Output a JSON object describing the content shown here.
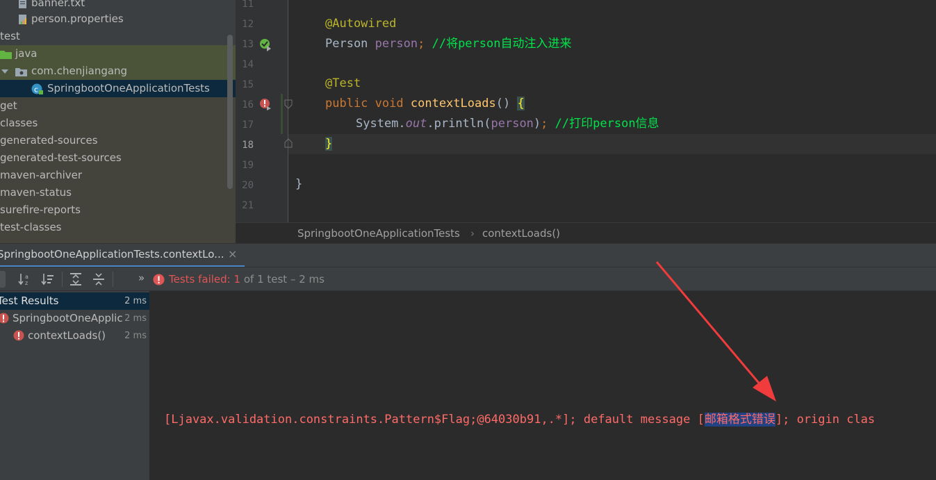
{
  "project_tree": {
    "items": [
      {
        "label": "banner.txt",
        "icon": "text-file-icon"
      },
      {
        "label": "person.properties",
        "icon": "properties-file-icon"
      },
      {
        "label": "test",
        "icon": "none"
      },
      {
        "label": "java",
        "icon": "folder-icon"
      },
      {
        "label": "com.chenjiangang",
        "icon": "package-icon"
      },
      {
        "label": "SpringbootOneApplicationTests",
        "icon": "test-class-icon"
      },
      {
        "label": "get",
        "icon": "none"
      },
      {
        "label": "classes",
        "icon": "none"
      },
      {
        "label": "generated-sources",
        "icon": "none"
      },
      {
        "label": "generated-test-sources",
        "icon": "none"
      },
      {
        "label": "maven-archiver",
        "icon": "none"
      },
      {
        "label": "maven-status",
        "icon": "none"
      },
      {
        "label": "surefire-reports",
        "icon": "none"
      },
      {
        "label": "test-classes",
        "icon": "none"
      }
    ]
  },
  "editor": {
    "line_numbers": [
      "11",
      "12",
      "13",
      "14",
      "15",
      "16",
      "17",
      "18",
      "19",
      "20",
      "21"
    ],
    "code": {
      "l12": "@Autowired",
      "l13_type": "Person",
      "l13_field": "person",
      "l13_semi": ";",
      "l13_comment": "//将person自动注入进来",
      "l15": "@Test",
      "l16_kw1": "public",
      "l16_kw2": "void",
      "l16_method": "contextLoads",
      "l16_parens": "()",
      "l16_brace": "{",
      "l17_class": "System.",
      "l17_static": "out",
      "l17_call": ".println(",
      "l17_arg": "person",
      "l17_close": ")",
      "l17_semi": ";",
      "l17_comment": "//打印person信息",
      "l18": "}",
      "l20": "}"
    },
    "breadcrumbs": {
      "class": "SpringbootOneApplicationTests",
      "separator": "›",
      "method": "contextLoads()"
    }
  },
  "run_panel": {
    "tab_label": "SpringbootOneApplicationTests.contextLo...",
    "tab_close": "×",
    "overflow": "»",
    "status_prefix": "Tests failed:",
    "status_count": "1",
    "status_suffix": "of 1 test – 2 ms",
    "results": {
      "header_label": "Test Results",
      "header_time": "2 ms",
      "class_label": "SpringbootOneApplic",
      "class_time": "2 ms",
      "method_label": "contextLoads()",
      "method_time": "2 ms"
    },
    "console": {
      "before": "[Ljavax.validation.constraints.Pattern$Flag;@64030b91,.*]; default message [",
      "selected": "邮箱格式错误",
      "after": "]; origin clas"
    }
  },
  "colors": {
    "error_red": "#e05555",
    "annotation_arrow": "#f03c3c",
    "selection_blue": "#0d293e"
  }
}
